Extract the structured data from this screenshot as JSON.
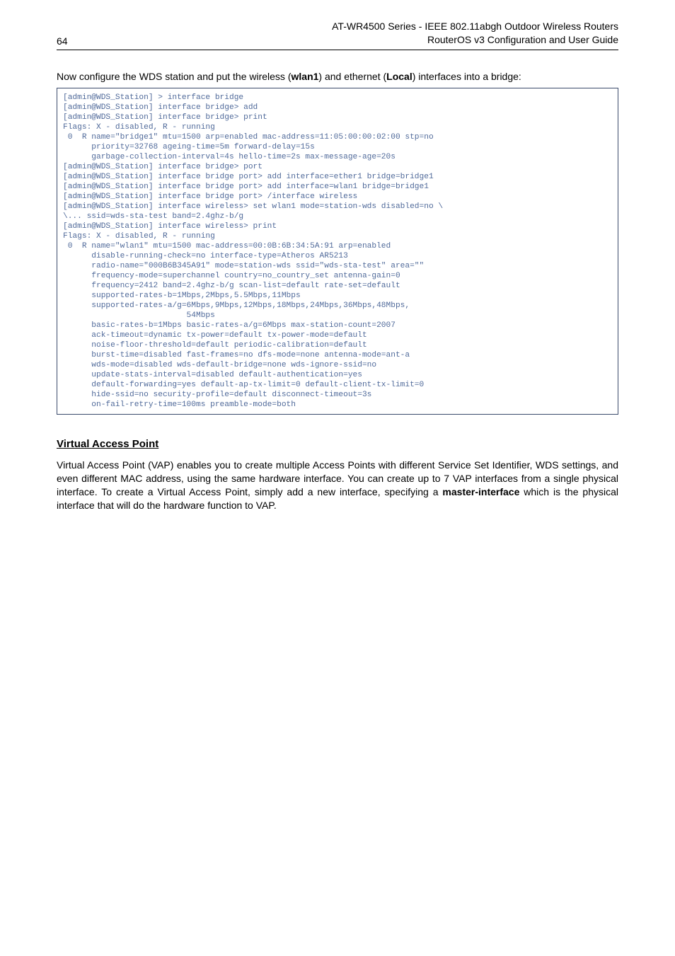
{
  "header": {
    "page_number": "64",
    "title_line1": "AT-WR4500 Series - IEEE 802.11abgh Outdoor Wireless Routers",
    "title_line2": "RouterOS v3 Configuration and User Guide"
  },
  "intro": {
    "pre": "Now configure the WDS station and put the wireless (",
    "wlan": "wlan1",
    "mid": ") and ethernet (",
    "local": "Local",
    "post": ") interfaces into a bridge:"
  },
  "code": "[admin@WDS_Station] > interface bridge\n[admin@WDS_Station] interface bridge> add\n[admin@WDS_Station] interface bridge> print\nFlags: X - disabled, R - running\n 0  R name=\"bridge1\" mtu=1500 arp=enabled mac-address=11:05:00:00:02:00 stp=no\n      priority=32768 ageing-time=5m forward-delay=15s\n      garbage-collection-interval=4s hello-time=2s max-message-age=20s\n[admin@WDS_Station] interface bridge> port\n[admin@WDS_Station] interface bridge port> add interface=ether1 bridge=bridge1\n[admin@WDS_Station] interface bridge port> add interface=wlan1 bridge=bridge1\n[admin@WDS_Station] interface bridge port> /interface wireless\n[admin@WDS_Station] interface wireless> set wlan1 mode=station-wds disabled=no \\\n\\... ssid=wds-sta-test band=2.4ghz-b/g\n[admin@WDS_Station] interface wireless> print\nFlags: X - disabled, R - running\n 0  R name=\"wlan1\" mtu=1500 mac-address=00:0B:6B:34:5A:91 arp=enabled\n      disable-running-check=no interface-type=Atheros AR5213\n      radio-name=\"000B6B345A91\" mode=station-wds ssid=\"wds-sta-test\" area=\"\"\n      frequency-mode=superchannel country=no_country_set antenna-gain=0\n      frequency=2412 band=2.4ghz-b/g scan-list=default rate-set=default\n      supported-rates-b=1Mbps,2Mbps,5.5Mbps,11Mbps\n      supported-rates-a/g=6Mbps,9Mbps,12Mbps,18Mbps,24Mbps,36Mbps,48Mbps,\n                          54Mbps\n      basic-rates-b=1Mbps basic-rates-a/g=6Mbps max-station-count=2007\n      ack-timeout=dynamic tx-power=default tx-power-mode=default\n      noise-floor-threshold=default periodic-calibration=default\n      burst-time=disabled fast-frames=no dfs-mode=none antenna-mode=ant-a\n      wds-mode=disabled wds-default-bridge=none wds-ignore-ssid=no\n      update-stats-interval=disabled default-authentication=yes\n      default-forwarding=yes default-ap-tx-limit=0 default-client-tx-limit=0\n      hide-ssid=no security-profile=default disconnect-timeout=3s\n      on-fail-retry-time=100ms preamble-mode=both",
  "section": {
    "heading": "Virtual Access Point",
    "p1a": "Virtual Access Point (VAP) enables you to create multiple Access Points with different Service Set Identifier, WDS settings, and even different MAC address, using the same hardware interface. You can create up to 7 VAP interfaces from a single physical interface. To create a Virtual Access Point, simply add a new interface, specifying a ",
    "p1b": "master-interface",
    "p1c": " which is the physical interface that will do the hardware function to VAP."
  }
}
